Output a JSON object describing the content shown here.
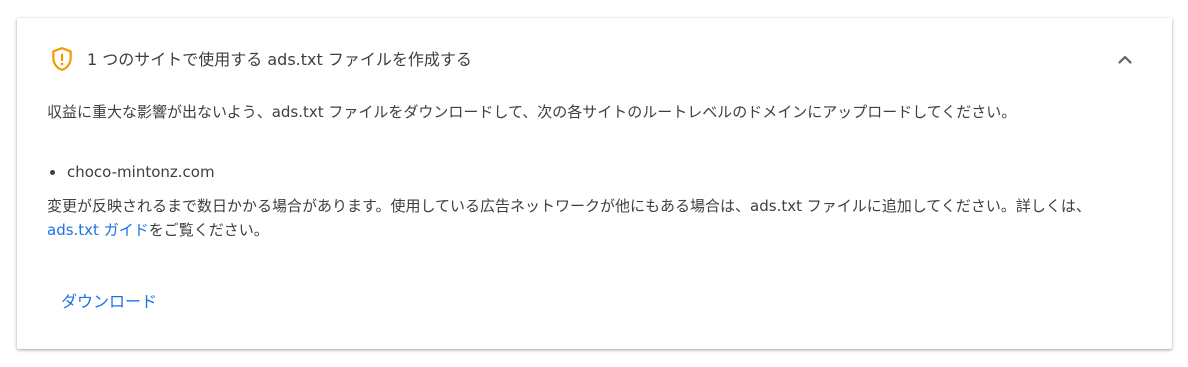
{
  "card": {
    "title": "1 つのサイトで使用する ads.txt ファイルを作成する",
    "header_icon": "shield-warning-icon",
    "collapse_icon": "chevron-up-icon",
    "accent_color": "#f29900",
    "link_color": "#1a73e8",
    "description": "収益に重大な影響が出ないよう、ads.txt ファイルをダウンロードして、次の各サイトのルートレベルのドメインにアップロードしてください。",
    "sites": [
      "choco-mintonz.com"
    ],
    "note_before_link": "変更が反映されるまで数日かかる場合があります。使用している広告ネットワークが他にもある場合は、ads.txt ファイルに追加してください。詳しくは、",
    "note_link": "ads.txt ガイド",
    "note_after_link": "をご覧ください。",
    "download_label": "ダウンロード"
  }
}
